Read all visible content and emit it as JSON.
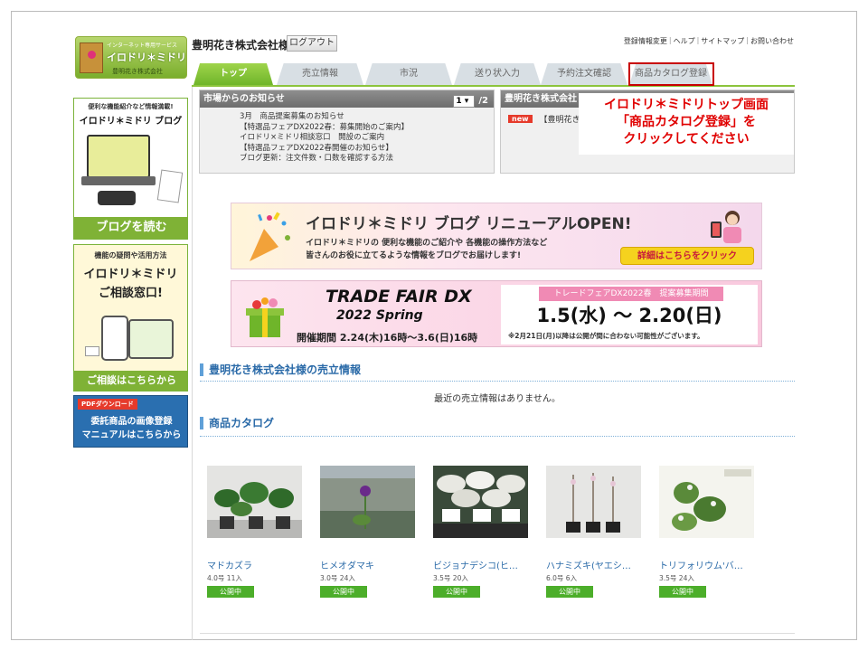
{
  "header": {
    "logo_line1": "インターネット専用サービス",
    "logo_line2": "イロドリ＊ミドリ",
    "logo_line3": "豊明花き株式会社",
    "company": "豊明花き株式会社様",
    "logout": "ログアウト",
    "links": [
      "登録情報変更",
      "ヘルプ",
      "サイトマップ",
      "お問い合わせ"
    ]
  },
  "tabs": [
    "トップ",
    "売立情報",
    "市況",
    "送り状入力",
    "予約注文確認",
    "商品カタログ登録"
  ],
  "sidebar": {
    "blog": {
      "line1": "便利な機能紹介など情報満載!",
      "line2": "イロドリ＊ミドリ ブログ",
      "cta": "ブログを読む"
    },
    "consult": {
      "line1": "機能の疑問や活用方法",
      "line2": "イロドリ＊ミドリ",
      "line3": "ご相談窓口!",
      "cta": "ご相談はこちらから"
    },
    "pdf": {
      "tag": "PDFダウンロード",
      "line1": "委託商品の画像登録",
      "line2": "マニュアルはこちらから"
    }
  },
  "news": {
    "title": "市場からのお知らせ",
    "page_select": "1",
    "page_total": "/2",
    "items": [
      "3月　商品提案募集のお知らせ",
      "【特選品フェアDX2022春：募集開始のご案内】",
      "イロドリ×ミドリ相談窓口　開設のご案内",
      "【特選品フェアDX2022春開催のお知らせ】",
      "ブログ更新：注文件数・口数を確認する方法"
    ]
  },
  "news2": {
    "title": "豊明花き株式会社",
    "badge": "new",
    "text": "【豊明花き"
  },
  "callout": {
    "line1": "イロドリ＊ミドリトップ画面",
    "line2": "「商品カタログ登録」を",
    "line3": "クリックしてください"
  },
  "banner_blog": {
    "title": "イロドリ＊ミドリ ブログ リニューアルOPEN!",
    "sub1": "イロドリ＊ミドリの 便利な機能のご紹介や 各機能の操作方法など",
    "sub2": "皆さんのお役に立てるような情報をブログでお届けします!",
    "button": "詳細はこちらをクリック"
  },
  "banner_fair": {
    "title": "TRADE FAIR DX",
    "year": "2022 Spring",
    "period": "開催期間 2.24(木)16時～3.6(日)16時",
    "head": "トレードフェアDX2022春　提案募集期間",
    "dates": "1.5(水) ～ 2.20(日)",
    "note": "※2月21日(月)以降は公開が間に合わない可能性がございます。"
  },
  "sales": {
    "title": "豊明花き株式会社様の売立情報",
    "empty": "最近の売立情報はありません。"
  },
  "catalog": {
    "title": "商品カタログ",
    "products": [
      {
        "name": "マドカズラ",
        "meta": "4.0号 11入",
        "status": "公開中"
      },
      {
        "name": "ヒメオダマキ",
        "meta": "3.0号 24入",
        "status": "公開中"
      },
      {
        "name": "ビジョナデシコ(ヒ…",
        "meta": "3.5号 20入",
        "status": "公開中"
      },
      {
        "name": "ハナミズキ(ヤエシ…",
        "meta": "6.0号 6入",
        "status": "公開中"
      },
      {
        "name": "トリフォリウム'バ…",
        "meta": "3.5号 24入",
        "status": "公開中"
      }
    ]
  },
  "colors": {
    "accent_green": "#7fb236",
    "tab_active": "#6fb52a",
    "link_blue": "#2a6aa8",
    "alert_red": "#e00000"
  }
}
